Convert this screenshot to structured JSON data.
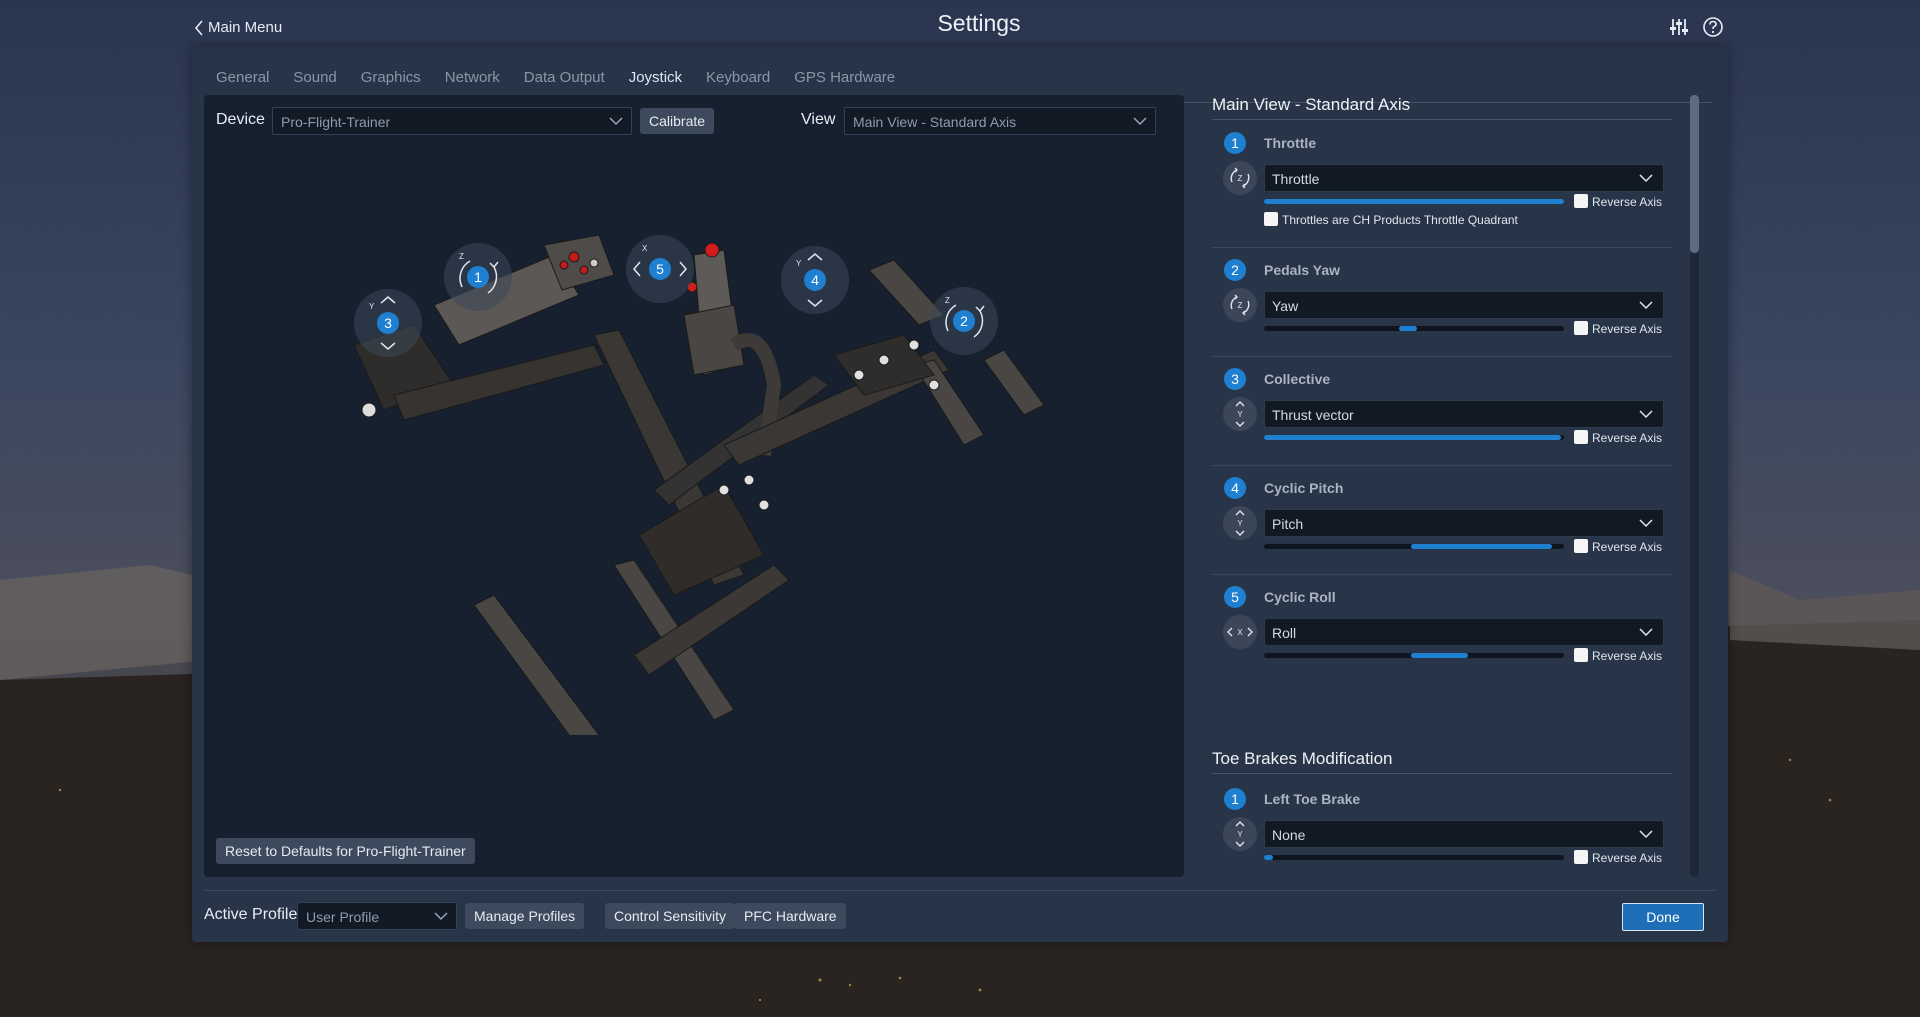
{
  "header": {
    "back_label": "Main Menu",
    "title": "Settings"
  },
  "icons": {
    "back": "chevron-left-icon",
    "sliders": "sliders-icon",
    "help": "help-icon"
  },
  "tabs": [
    {
      "label": "General",
      "active": false
    },
    {
      "label": "Sound",
      "active": false
    },
    {
      "label": "Graphics",
      "active": false
    },
    {
      "label": "Network",
      "active": false
    },
    {
      "label": "Data Output",
      "active": false
    },
    {
      "label": "Joystick",
      "active": true
    },
    {
      "label": "Keyboard",
      "active": false
    },
    {
      "label": "GPS Hardware",
      "active": false
    }
  ],
  "left": {
    "device_label": "Device",
    "device_value": "Pro-Flight-Trainer",
    "calibrate_label": "Calibrate",
    "view_label": "View",
    "view_value": "Main View - Standard Axis",
    "reset_label": "Reset to Defaults for Pro-Flight-Trainer",
    "markers": [
      {
        "num": "1",
        "axis": "Z"
      },
      {
        "num": "2",
        "axis": "Z"
      },
      {
        "num": "3",
        "axis": "Y"
      },
      {
        "num": "4",
        "axis": "Y"
      },
      {
        "num": "5",
        "axis": "X"
      }
    ]
  },
  "main_view": {
    "title": "Main View - Standard Axis",
    "axes": [
      {
        "num": "1",
        "name": "Throttle",
        "select": "Throttle",
        "level": [
          0,
          1.0
        ],
        "reverse_label": "Reverse Axis",
        "extra_label": "Throttles are CH Products Throttle Quadrant",
        "icon": "rotate-z-icon"
      },
      {
        "num": "2",
        "name": "Pedals Yaw",
        "select": "Yaw",
        "level": [
          0.45,
          0.51
        ],
        "reverse_label": "Reverse Axis",
        "icon": "rotate-z-icon"
      },
      {
        "num": "3",
        "name": "Collective",
        "select": "Thrust vector",
        "level": [
          0,
          0.99
        ],
        "reverse_label": "Reverse Axis",
        "icon": "up-down-y-icon"
      },
      {
        "num": "4",
        "name": "Cyclic Pitch",
        "select": "Pitch",
        "level": [
          0.49,
          0.96
        ],
        "reverse_label": "Reverse Axis",
        "icon": "up-down-y-icon"
      },
      {
        "num": "5",
        "name": "Cyclic Roll",
        "select": "Roll",
        "level": [
          0.49,
          0.68
        ],
        "reverse_label": "Reverse Axis",
        "icon": "left-right-x-icon"
      }
    ]
  },
  "toe_brakes": {
    "title": "Toe Brakes Modification",
    "axes": [
      {
        "num": "1",
        "name": "Left Toe Brake",
        "select": "None",
        "level": [
          0,
          0.03
        ],
        "reverse_label": "Reverse Axis",
        "icon": "up-down-y-icon"
      }
    ]
  },
  "footer": {
    "active_profile_label": "Active Profile",
    "profile_value": "User Profile",
    "manage_profiles": "Manage Profiles",
    "control_sensitivity": "Control Sensitivity",
    "pfc_hardware": "PFC Hardware",
    "done": "Done"
  }
}
